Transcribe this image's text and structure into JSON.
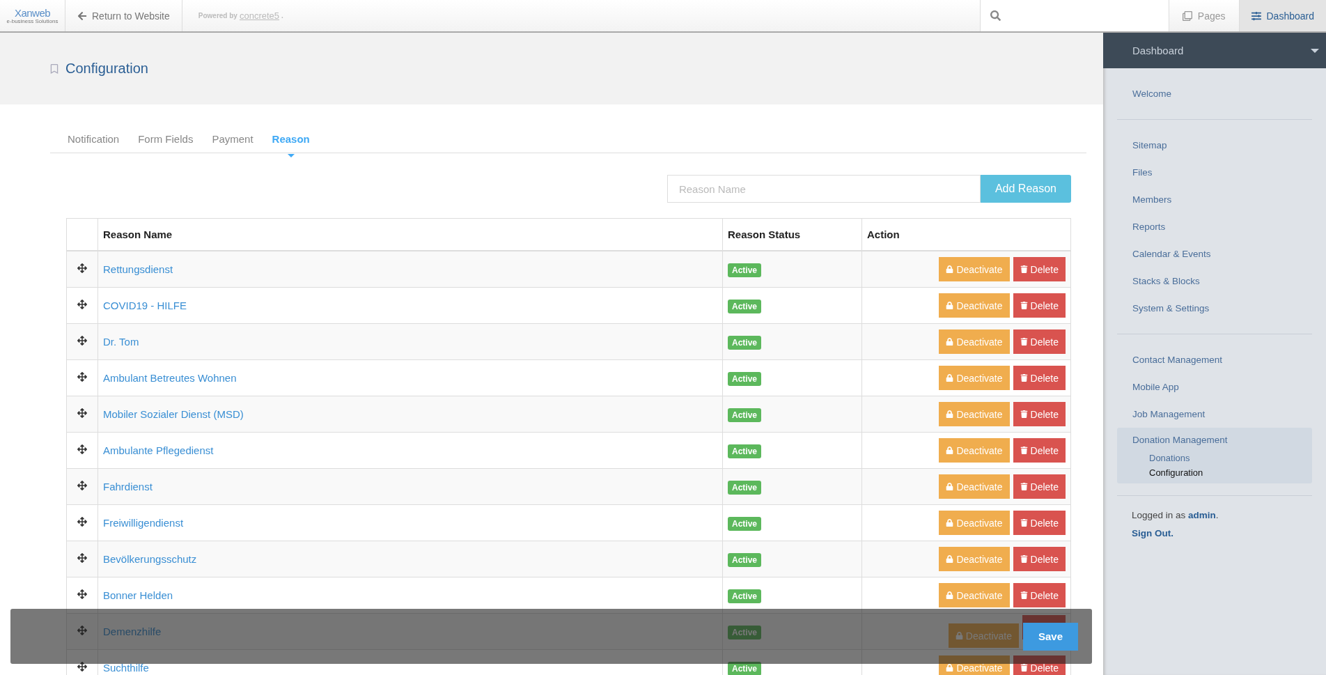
{
  "topbar": {
    "logo": {
      "name": "Xanweb",
      "tagline": "e-business Solutions"
    },
    "return_link": "Return to Website",
    "powered_by": {
      "label": "Powered by",
      "brand": "concrete5",
      "suffix": "."
    },
    "buttons": [
      {
        "label": "Pages",
        "selected": false
      },
      {
        "label": "Dashboard",
        "selected": true
      }
    ]
  },
  "header": {
    "title": "Configuration"
  },
  "tabs": [
    {
      "label": "Notification",
      "selected": false
    },
    {
      "label": "Form Fields",
      "selected": false
    },
    {
      "label": "Payment",
      "selected": false
    },
    {
      "label": "Reason",
      "selected": true
    }
  ],
  "add_form": {
    "placeholder": "Reason Name",
    "button": "Add Reason"
  },
  "table": {
    "columns": [
      "Reason Name",
      "Reason Status",
      "Action"
    ],
    "rows": [
      {
        "name": "Rettungsdienst",
        "status": "Active",
        "actions": [
          "Deactivate",
          "Delete"
        ]
      },
      {
        "name": "COVID19 - HILFE",
        "status": "Active",
        "actions": [
          "Deactivate",
          "Delete"
        ]
      },
      {
        "name": "Dr. Tom",
        "status": "Active",
        "actions": [
          "Deactivate",
          "Delete"
        ]
      },
      {
        "name": "Ambulant Betreutes Wohnen",
        "status": "Active",
        "actions": [
          "Deactivate",
          "Delete"
        ]
      },
      {
        "name": "Mobiler Sozialer Dienst (MSD)",
        "status": "Active",
        "actions": [
          "Deactivate",
          "Delete"
        ]
      },
      {
        "name": "Ambulante Pflegedienst",
        "status": "Active",
        "actions": [
          "Deactivate",
          "Delete"
        ]
      },
      {
        "name": "Fahrdienst",
        "status": "Active",
        "actions": [
          "Deactivate",
          "Delete"
        ]
      },
      {
        "name": "Freiwilligendienst",
        "status": "Active",
        "actions": [
          "Deactivate",
          "Delete"
        ]
      },
      {
        "name": "Bevölkerungsschutz",
        "status": "Active",
        "actions": [
          "Deactivate",
          "Delete"
        ]
      },
      {
        "name": "Bonner Helden",
        "status": "Active",
        "actions": [
          "Deactivate",
          "Delete"
        ]
      },
      {
        "name": "Demenzhilfe",
        "status": "Active",
        "actions": [
          "Deactivate"
        ]
      },
      {
        "name": "Suchthilfe",
        "status": "Active",
        "actions": [
          "Deactivate",
          "Delete"
        ]
      }
    ]
  },
  "sidebar": {
    "title": "Dashboard",
    "sections": [
      [
        {
          "label": "Welcome",
          "selected": false,
          "expanded": false
        }
      ],
      [
        {
          "label": "Sitemap",
          "selected": false,
          "expanded": false
        },
        {
          "label": "Files",
          "selected": false,
          "expanded": false
        },
        {
          "label": "Members",
          "selected": false,
          "expanded": false
        },
        {
          "label": "Reports",
          "selected": false,
          "expanded": false
        },
        {
          "label": "Calendar & Events",
          "selected": false,
          "expanded": false
        },
        {
          "label": "Stacks & Blocks",
          "selected": false,
          "expanded": false
        },
        {
          "label": "System & Settings",
          "selected": false,
          "expanded": false
        }
      ],
      [
        {
          "label": "Contact Management",
          "selected": false,
          "expanded": false
        },
        {
          "label": "Mobile App",
          "selected": false,
          "expanded": false
        },
        {
          "label": "Job Management",
          "selected": false,
          "expanded": false
        },
        {
          "label": "Donation Management",
          "selected": false,
          "expanded": true,
          "children": [
            {
              "label": "Donations",
              "selected": false
            },
            {
              "label": "Configuration",
              "selected": true
            }
          ]
        }
      ]
    ],
    "login_prefix": "Logged in as",
    "user": "admin",
    "login_suffix": ".",
    "sign_out": "Sign Out."
  },
  "save_bar": {
    "button": "Save"
  }
}
